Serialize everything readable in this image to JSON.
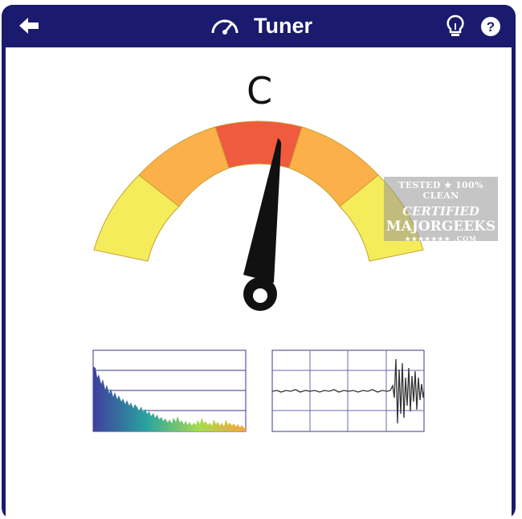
{
  "header": {
    "title": "Tuner",
    "background_color": "#1a1a6e",
    "back_icon": "back-arrow-icon",
    "gauge_icon": "gauge-icon",
    "hint_icon": "lightbulb-icon",
    "help_icon": "help-icon"
  },
  "tuner": {
    "note": "C",
    "needle_position": "slightly sharp, just right of center",
    "gauge_segments": [
      {
        "zone": "far-flat",
        "color": "#f5ec5c"
      },
      {
        "zone": "flat",
        "color": "#fbb04a"
      },
      {
        "zone": "in-tune",
        "color": "#f05a3f"
      },
      {
        "zone": "sharp",
        "color": "#fbb04a"
      },
      {
        "zone": "far-sharp",
        "color": "#f5ec5c"
      }
    ]
  },
  "panels": {
    "spectrum": {
      "type": "frequency-spectrum",
      "gradient": [
        "#3f3f9e",
        "#2aa3a0",
        "#a8dc4f",
        "#f9a23c"
      ]
    },
    "waveform": {
      "type": "waveform"
    }
  },
  "watermark": {
    "line1": "TESTED ★ 100% CLEAN",
    "line2": "CERTIFIED",
    "line3": "MAJORGEEKS",
    "line4": "★★★★★★★ .COM"
  }
}
